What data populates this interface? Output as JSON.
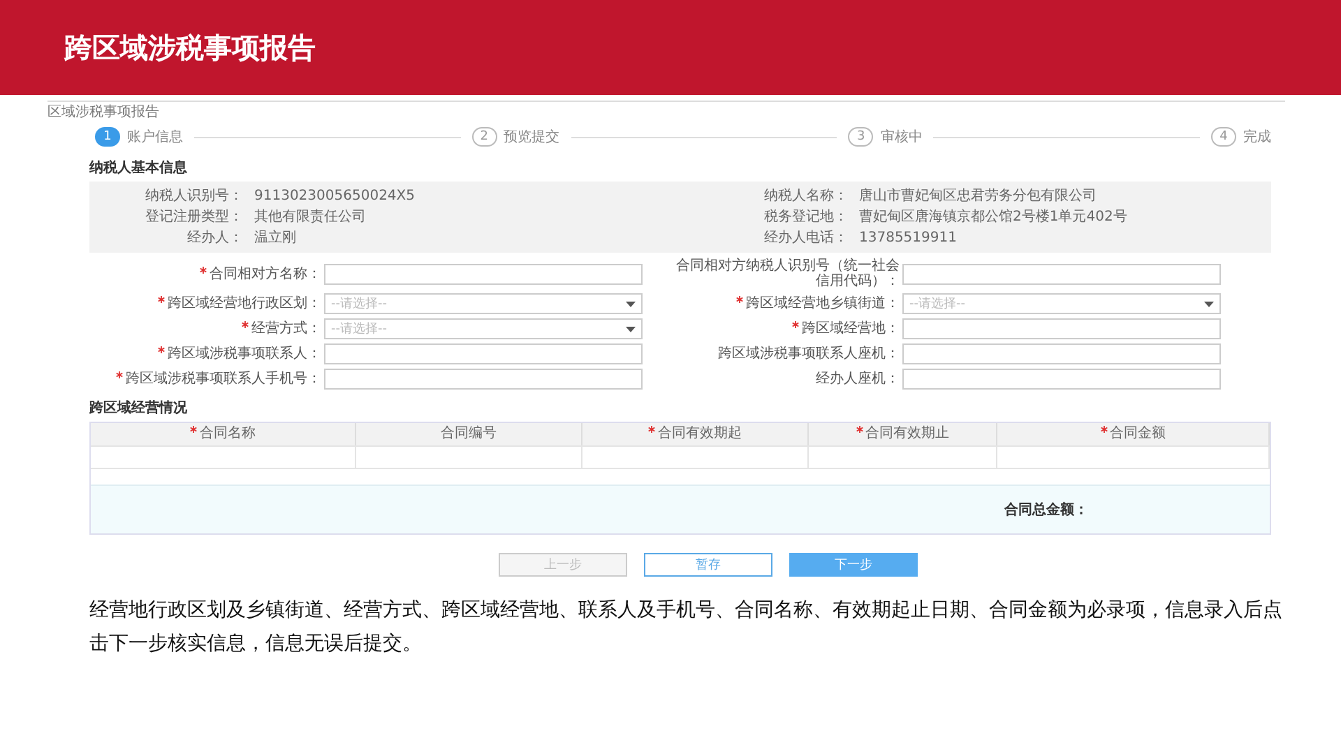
{
  "slide_title": "跨区域涉税事项报告",
  "breadcrumb": "区域涉税事项报告",
  "steps": [
    {
      "number": "1",
      "label": "账户信息",
      "selected": true
    },
    {
      "number": "2",
      "label": "预览提交",
      "selected": false
    },
    {
      "number": "3",
      "label": "审核中",
      "selected": false
    },
    {
      "number": "4",
      "label": "完成",
      "selected": false
    }
  ],
  "basic_info": {
    "title": "纳税人基本信息",
    "fields": [
      {
        "label": "纳税人识别号：",
        "value": "9113023005650024X5"
      },
      {
        "label": "纳税人名称：",
        "value": "唐山市曹妃甸区忠君劳务分包有限公司"
      },
      {
        "label": "登记注册类型：",
        "value": "其他有限责任公司"
      },
      {
        "label": "税务登记地：",
        "value": "曹妃甸区唐海镇京都公馆2号楼1单元402号"
      },
      {
        "label": "经办人：",
        "value": "温立刚"
      },
      {
        "label": "经办人电话：",
        "value": "13785519911"
      }
    ]
  },
  "form_fields": [
    {
      "label": "合同相对方名称：",
      "required": true,
      "kind": "text"
    },
    {
      "label": "合同相对方纳税人识别号（统一社会信用代码）：",
      "required": false,
      "kind": "text"
    },
    {
      "label": "跨区域经营地行政区划：",
      "required": true,
      "kind": "select",
      "placeholder": "--请选择--"
    },
    {
      "label": "跨区域经营地乡镇街道：",
      "required": true,
      "kind": "select",
      "placeholder": "--请选择--"
    },
    {
      "label": "经营方式：",
      "required": true,
      "kind": "select",
      "placeholder": "--请选择--"
    },
    {
      "label": "跨区域经营地：",
      "required": true,
      "kind": "text"
    },
    {
      "label": "跨区域涉税事项联系人：",
      "required": true,
      "kind": "text"
    },
    {
      "label": "跨区域涉税事项联系人座机：",
      "required": false,
      "kind": "text"
    },
    {
      "label": "跨区域涉税事项联系人手机号：",
      "required": true,
      "kind": "text"
    },
    {
      "label": "经办人座机：",
      "required": false,
      "kind": "text"
    }
  ],
  "contracts": {
    "title": "跨区域经营情况",
    "columns": [
      {
        "label": "合同名称",
        "required": true
      },
      {
        "label": "合同编号",
        "required": false
      },
      {
        "label": "合同有效期起",
        "required": true
      },
      {
        "label": "合同有效期止",
        "required": true
      },
      {
        "label": "合同金额",
        "required": true
      }
    ],
    "total_label": "合同总金额："
  },
  "buttons": [
    {
      "label": "上一步",
      "kind": "disabled"
    },
    {
      "label": "暂存",
      "kind": "outline"
    },
    {
      "label": "下一步",
      "kind": "primary"
    }
  ],
  "caption": "经营地行政区划及乡镇街道、经营方式、跨区域经营地、联系人及手机号、合同名称、有效期起止日期、合同金额为必录项，信息录入后点击下一步核实信息，信息无误后提交。"
}
